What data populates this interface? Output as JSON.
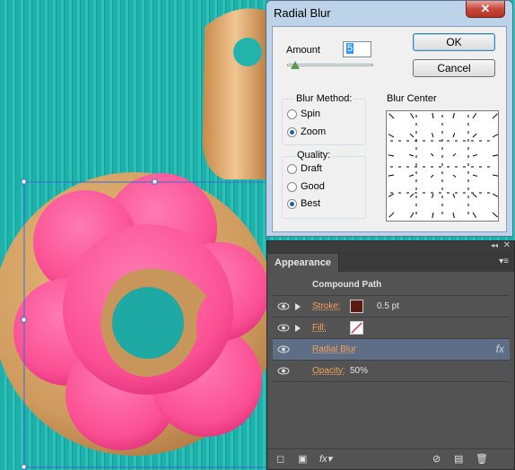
{
  "dialog": {
    "title": "Radial Blur",
    "close_glyph": "✕",
    "amount_label": "Amount",
    "amount_value": "5",
    "amount_slider_fraction": 0.05,
    "ok_label": "OK",
    "cancel_label": "Cancel",
    "blur_method": {
      "title": "Blur Method:",
      "options": [
        "Spin",
        "Zoom"
      ],
      "selected": "Zoom"
    },
    "quality": {
      "title": "Quality:",
      "options": [
        "Draft",
        "Good",
        "Best"
      ],
      "selected": "Best"
    },
    "blur_center_label": "Blur Center"
  },
  "panel": {
    "tab_label": "Appearance",
    "header": "Compound Path",
    "rows": [
      {
        "label": "Stroke:",
        "swatch": "#5a1a10",
        "value": "0.5 pt",
        "expandable": true
      },
      {
        "label": "Fill:",
        "swatch": "none",
        "value": "",
        "expandable": true
      },
      {
        "label": "Radial Blur",
        "value": "fx",
        "selected": true
      },
      {
        "label": "Opacity:",
        "value": "50%"
      }
    ],
    "collapse_glyph": "◂◂",
    "close_glyph": "✕",
    "menu_glyph": "▾≡",
    "bottom_icons": [
      "square-icon",
      "layer-icon",
      "fx-icon",
      "no-icon",
      "new-item-icon",
      "trash-icon"
    ],
    "bottom_fx_label": "fx"
  },
  "colors": {
    "canvas_teal": "#22b3ad",
    "frosting_pink": "#fb5a9a",
    "cookie_tan": "#d6a46a",
    "selection_blue": "#3a6cc8",
    "accent_orange": "#f5a25d"
  }
}
